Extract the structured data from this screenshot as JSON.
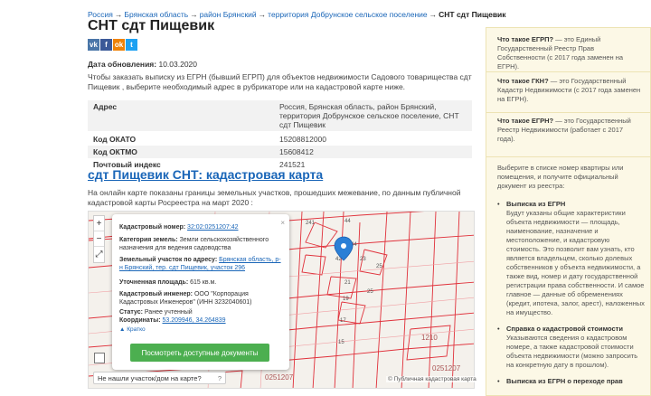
{
  "breadcrumb": {
    "items": [
      "Россия",
      "Брянская область",
      "район Брянский",
      "территория Добрунское сельское поселение"
    ],
    "separator": "→",
    "current": "СНТ сдт Пищевик"
  },
  "page": {
    "title": "СНТ сдт Пищевик",
    "updated_label": "Дата обновления:",
    "updated_value": "10.03.2020",
    "intro": "Чтобы заказать выписку из ЕГРН (бывший ЕГРП) для объектов недвижимости Садового товарищества сдт Пищевик , выберите необходимый адрес в рубрикаторе или на кадастровой карте ниже."
  },
  "share": [
    {
      "name": "vk-icon",
      "glyph": "vk"
    },
    {
      "name": "facebook-icon",
      "glyph": "f"
    },
    {
      "name": "odnoklassniki-icon",
      "glyph": "ok"
    },
    {
      "name": "twitter-icon",
      "glyph": "t"
    }
  ],
  "info_table": [
    {
      "key": "Адрес",
      "value": "Россия, Брянская область, район Брянский, территория Добрунское сельское поселение, СНТ сдт Пищевик"
    },
    {
      "key": "Код ОКАТО",
      "value": "15208812000"
    },
    {
      "key": "Код ОКТМО",
      "value": "15608412"
    },
    {
      "key": "Почтовый индекс",
      "value": "241521"
    }
  ],
  "map_section": {
    "title": "сдт Пищевик СНТ: кадастровая карта",
    "description": "На онлайн карте показаны границы земельных участков, прошедших межевание, по данным публичной кадастровой карты Росреестра на март 2020 :"
  },
  "map": {
    "zoom_in": "+",
    "zoom_out": "−",
    "fullscreen": "⤢",
    "help_text": "Не нашли участок/дом на карте?",
    "help_icon": "?",
    "attribution": "© Публичная кадастровая карта",
    "parcel_labels": [
      "241",
      "44",
      "44",
      "42",
      "23",
      "25",
      "21",
      "19",
      "17",
      "15",
      "25",
      "1210",
      "0251207",
      "0251207"
    ]
  },
  "popup": {
    "close": "×",
    "cad_label": "Кадастровый номер:",
    "cad_value": "32:02:0251207:42",
    "category_label": "Категория земель:",
    "category_value": "Земли сельскохозяйственного назначения для ведения садоводства",
    "address_label": "Земельный участок по адресу:",
    "address_value": "Брянская область, р-н Брянский, тер. сдт Пищевик, участок 296",
    "area_label": "Уточненная площадь:",
    "area_value": "615 кв.м.",
    "engineer_label": "Кадастровый инженер:",
    "engineer_value": "ООО \"Корпорация Кадастровых Инженеров\" (ИНН 3232040601)",
    "status_label": "Статус:",
    "status_value": "Ранее учтенный",
    "coords_label": "Координаты:",
    "coords_value": "53.209946, 34.264839",
    "more": "▲ Кратко",
    "button": "Посмотреть доступные документы"
  },
  "sidebar": {
    "faq": [
      {
        "term": "Что такое ЕГРП?",
        "text": " — это Единый Государственный Реестр Прав Собственности (с 2017 года заменен на ЕГРН)."
      },
      {
        "term": "Что такое ГКН?",
        "text": " — это Государственный Кадастр Недвижимости (с 2017 года заменен на ЕГРН)."
      },
      {
        "term": "Что такое ЕГРН?",
        "text": " — это Государственный Реестр Недвижимости (работает с 2017 года)."
      }
    ],
    "choose_text": "Выберите в списке номер квартиры или помещения, и получите официальный документ из реестра:",
    "items": [
      {
        "title": "Выписка из ЕГРН",
        "text": "Будут указаны общие характеристики объекта недвижимости — площадь, наименование, назначение и местоположение, и кадастровую стоимость. Это позволит вам узнать, кто является владельцем, сколько долевых собственников у объекта недвижимости, а также вид, номер и дату государственной регистрации права собственности. И самое главное — данные об обременениях (кредит, ипотека, залог, арест), наложенных на имущество."
      },
      {
        "title": "Справка о кадастровой стоимости",
        "text": "Указываются сведения о кадастровом номере, а также кадастровой стоимости объекта недвижимости (можно запросить на конкретную дату в прошлом)."
      },
      {
        "title": "Выписка из ЕГРН о переходе прав",
        "text": ""
      }
    ]
  },
  "colors": {
    "link": "#1a66b8",
    "parcel_line": "#e0303a",
    "button": "#4caf50",
    "sidebar_bg": "#fcf8e6",
    "marker": "#2b7fd6"
  }
}
